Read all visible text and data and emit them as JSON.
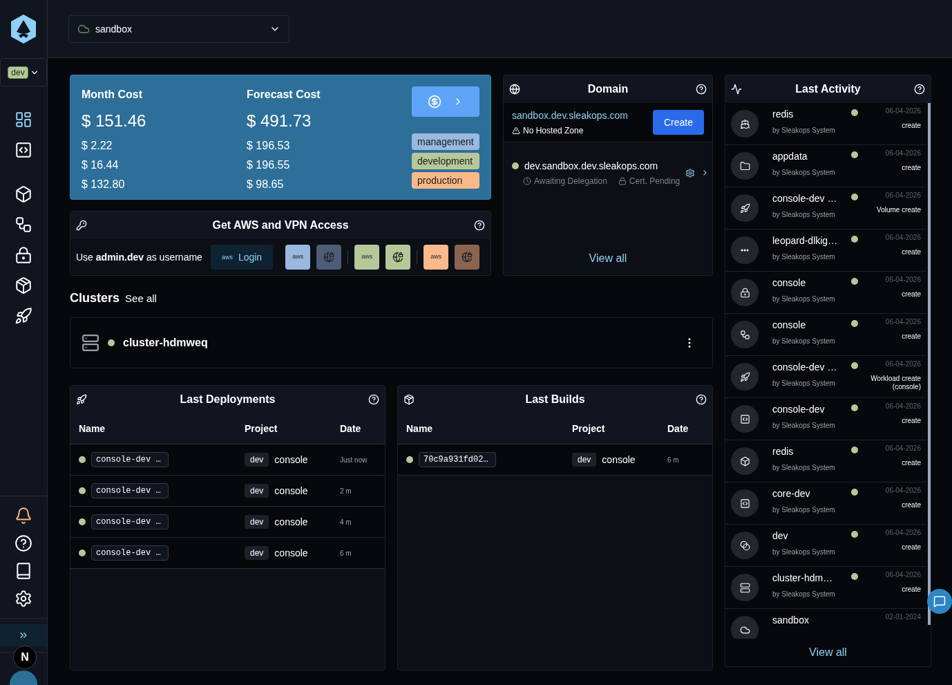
{
  "sidebar": {
    "env": "dev",
    "nav": [
      {
        "kind": "dashboard",
        "selected": true
      },
      {
        "kind": "code",
        "selected": false
      },
      {
        "kind": "box",
        "selected": false
      },
      {
        "kind": "workflow",
        "selected": false
      },
      {
        "kind": "lock",
        "selected": false
      },
      {
        "kind": "package",
        "selected": false
      },
      {
        "kind": "rocket",
        "selected": false
      }
    ],
    "bottom": [
      {
        "kind": "bell"
      },
      {
        "kind": "help"
      },
      {
        "kind": "book"
      },
      {
        "kind": "settings"
      }
    ],
    "badge": "N"
  },
  "header": {
    "account": "sandbox"
  },
  "cost": {
    "columns": [
      {
        "label": "Month Cost",
        "total": "$ 151.46",
        "items": [
          "$ 2.22",
          "$ 16.44",
          "$ 132.80"
        ]
      },
      {
        "label": "Forecast Cost",
        "total": "$ 491.73",
        "items": [
          "$ 196.53",
          "$ 196.55",
          "$ 98.65"
        ]
      }
    ],
    "tags": [
      {
        "label": "management",
        "color": "#9ab8e0"
      },
      {
        "label": "development",
        "color": "#b6c89a"
      },
      {
        "label": "production",
        "color": "#f9b98a"
      }
    ]
  },
  "access": {
    "title": "Get AWS and VPN Access",
    "hint": "Use **admin.dev** as username",
    "login_logo": "aws",
    "login": "Login",
    "groups": [
      {
        "buttons": [
          {
            "kind": "aws",
            "logo": "aws",
            "color": "#9ab8e0"
          },
          {
            "kind": "vpn",
            "color": "#4d5d78"
          }
        ]
      },
      {
        "buttons": [
          {
            "kind": "aws",
            "logo": "aws",
            "color": "#b6c89a"
          },
          {
            "kind": "vpn",
            "color": "#b6c89a"
          }
        ]
      },
      {
        "buttons": [
          {
            "kind": "aws",
            "logo": "aws",
            "color": "#f9b98a"
          },
          {
            "kind": "vpn",
            "color": "#8a6450"
          }
        ]
      }
    ]
  },
  "domain": {
    "title": "Domain",
    "main": "sandbox.dev.sleakops.com",
    "warning": "No Hosted Zone",
    "create": "Create",
    "entries": [
      {
        "name": "dev.sandbox.dev.sleakops.com",
        "delegation": "Awaiting Delegation",
        "cert": "Cert. Pending"
      }
    ],
    "view_all": "View all"
  },
  "clusters": {
    "title": "Clusters",
    "see_all": "See all",
    "items": [
      {
        "name": "cluster-hdmweq"
      }
    ]
  },
  "deployments": {
    "title": "Last Deployments",
    "columns": [
      "Name",
      "Project",
      "Date"
    ],
    "rows": [
      {
        "name": "console-dev …",
        "env": "dev",
        "project": "console",
        "date": "Just now"
      },
      {
        "name": "console-dev …",
        "env": "dev",
        "project": "console",
        "date": "2 m"
      },
      {
        "name": "console-dev …",
        "env": "dev",
        "project": "console",
        "date": "4 m"
      },
      {
        "name": "console-dev …",
        "env": "dev",
        "project": "console",
        "date": "6 m"
      }
    ]
  },
  "builds": {
    "title": "Last Builds",
    "columns": [
      "Name",
      "Project",
      "Date"
    ],
    "rows": [
      {
        "name": "70c9a931fd02…",
        "env": "dev",
        "project": "console",
        "date": "6 m"
      }
    ]
  },
  "activity": {
    "title": "Last Activity",
    "view_all": "View all",
    "items": [
      {
        "kind": "helm",
        "name": "redis",
        "by": "by Sleakops System",
        "date": "06-04-2026",
        "action": "create"
      },
      {
        "kind": "folder",
        "name": "appdata",
        "by": "by Sleakops System",
        "date": "06-04-2026",
        "action": "create"
      },
      {
        "kind": "rocket",
        "name": "console-dev …",
        "by": "by Sleakops System",
        "date": "06-04-2026",
        "action": "Volume create"
      },
      {
        "kind": "more",
        "name": "leopard-dlkig…",
        "by": "by Sleakops System",
        "date": "06-04-2026",
        "action": "create"
      },
      {
        "kind": "lock",
        "name": "console",
        "by": "by Sleakops System",
        "date": "06-04-2026",
        "action": "create"
      },
      {
        "kind": "workflow",
        "name": "console",
        "by": "by Sleakops System",
        "date": "06-04-2026",
        "action": "create"
      },
      {
        "kind": "rocket",
        "name": "console-dev …",
        "by": "by Sleakops System",
        "date": "06-04-2026",
        "action": "Workload create (console)"
      },
      {
        "kind": "code",
        "name": "console-dev",
        "by": "by Sleakops System",
        "date": "06-04-2026",
        "action": "create"
      },
      {
        "kind": "box",
        "name": "redis",
        "by": "by Sleakops System",
        "date": "06-04-2026",
        "action": "create"
      },
      {
        "kind": "code",
        "name": "core-dev",
        "by": "by Sleakops System",
        "date": "06-04-2026",
        "action": "create"
      },
      {
        "kind": "circles",
        "name": "dev",
        "by": "by Sleakops System",
        "date": "06-04-2026",
        "action": "create"
      },
      {
        "kind": "server",
        "name": "cluster-hdm…",
        "by": "by Sleakops System",
        "date": "06-04-2026",
        "action": "create"
      },
      {
        "kind": "cloud",
        "name": "sandbox",
        "date": "02-01-2024"
      }
    ]
  }
}
